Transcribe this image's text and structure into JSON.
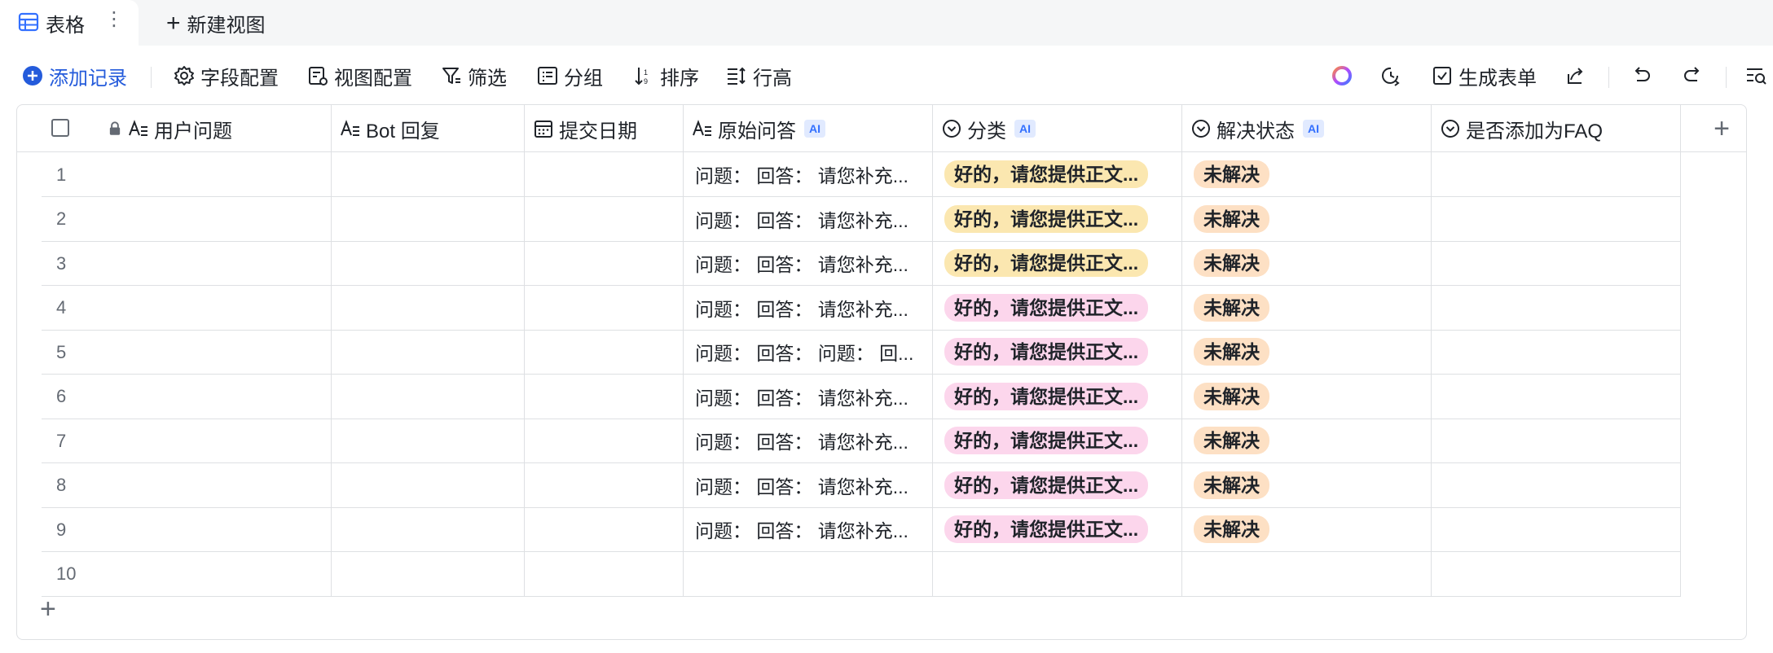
{
  "tabs": {
    "active_label": "表格",
    "more": "⋮",
    "new_view_label": "新建视图"
  },
  "toolbar": {
    "add_record": "添加记录",
    "field_config": "字段配置",
    "view_config": "视图配置",
    "filter": "筛选",
    "group": "分组",
    "sort": "排序",
    "row_height": "行高",
    "generate_form": "生成表单"
  },
  "columns": [
    {
      "label": "用户问题",
      "ai": ""
    },
    {
      "label": "Bot 回复",
      "ai": ""
    },
    {
      "label": "提交日期",
      "ai": ""
    },
    {
      "label": "原始问答",
      "ai": "AI"
    },
    {
      "label": "分类",
      "ai": "AI"
    },
    {
      "label": "解决状态",
      "ai": "AI"
    },
    {
      "label": "是否添加为FAQ",
      "ai": ""
    }
  ],
  "rows": [
    {
      "num": "1",
      "qa": "问题： 回答： 请您补充...",
      "category": "好的，请您提供正文...",
      "cat_color": "#fbe7b0",
      "status": "未解决"
    },
    {
      "num": "2",
      "qa": "问题： 回答： 请您补充...",
      "category": "好的，请您提供正文...",
      "cat_color": "#fbe7b0",
      "status": "未解决"
    },
    {
      "num": "3",
      "qa": "问题： 回答：  请您补充...",
      "category": "好的，请您提供正文...",
      "cat_color": "#fbe7b0",
      "status": "未解决"
    },
    {
      "num": "4",
      "qa": "问题： 回答：  请您补充...",
      "category": "好的，请您提供正文...",
      "cat_color": "#fcd6ec",
      "status": "未解决"
    },
    {
      "num": "5",
      "qa": "问题： 回答： 问题： 回...",
      "category": "好的，请您提供正文...",
      "cat_color": "#fcd6ec",
      "status": "未解决"
    },
    {
      "num": "6",
      "qa": "问题： 回答：  请您补充...",
      "category": "好的，请您提供正文...",
      "cat_color": "#fcd6ec",
      "status": "未解决"
    },
    {
      "num": "7",
      "qa": "问题： 回答：  请您补充...",
      "category": "好的，请您提供正文...",
      "cat_color": "#fcd6ec",
      "status": "未解决"
    },
    {
      "num": "8",
      "qa": "问题： 回答：  请您补充...",
      "category": "好的，请您提供正文...",
      "cat_color": "#fcd6ec",
      "status": "未解决"
    },
    {
      "num": "9",
      "qa": "问题： 回答：  请您补充...",
      "category": "好的，请您提供正文...",
      "cat_color": "#fcd6ec",
      "status": "未解决"
    },
    {
      "num": "10",
      "qa": "",
      "category": "",
      "cat_color": "",
      "status": ""
    }
  ],
  "colors": {
    "accent": "#245bdb",
    "status_tag": "#fde0c4"
  },
  "icons": {
    "add_row": "+",
    "add_column": "+"
  }
}
